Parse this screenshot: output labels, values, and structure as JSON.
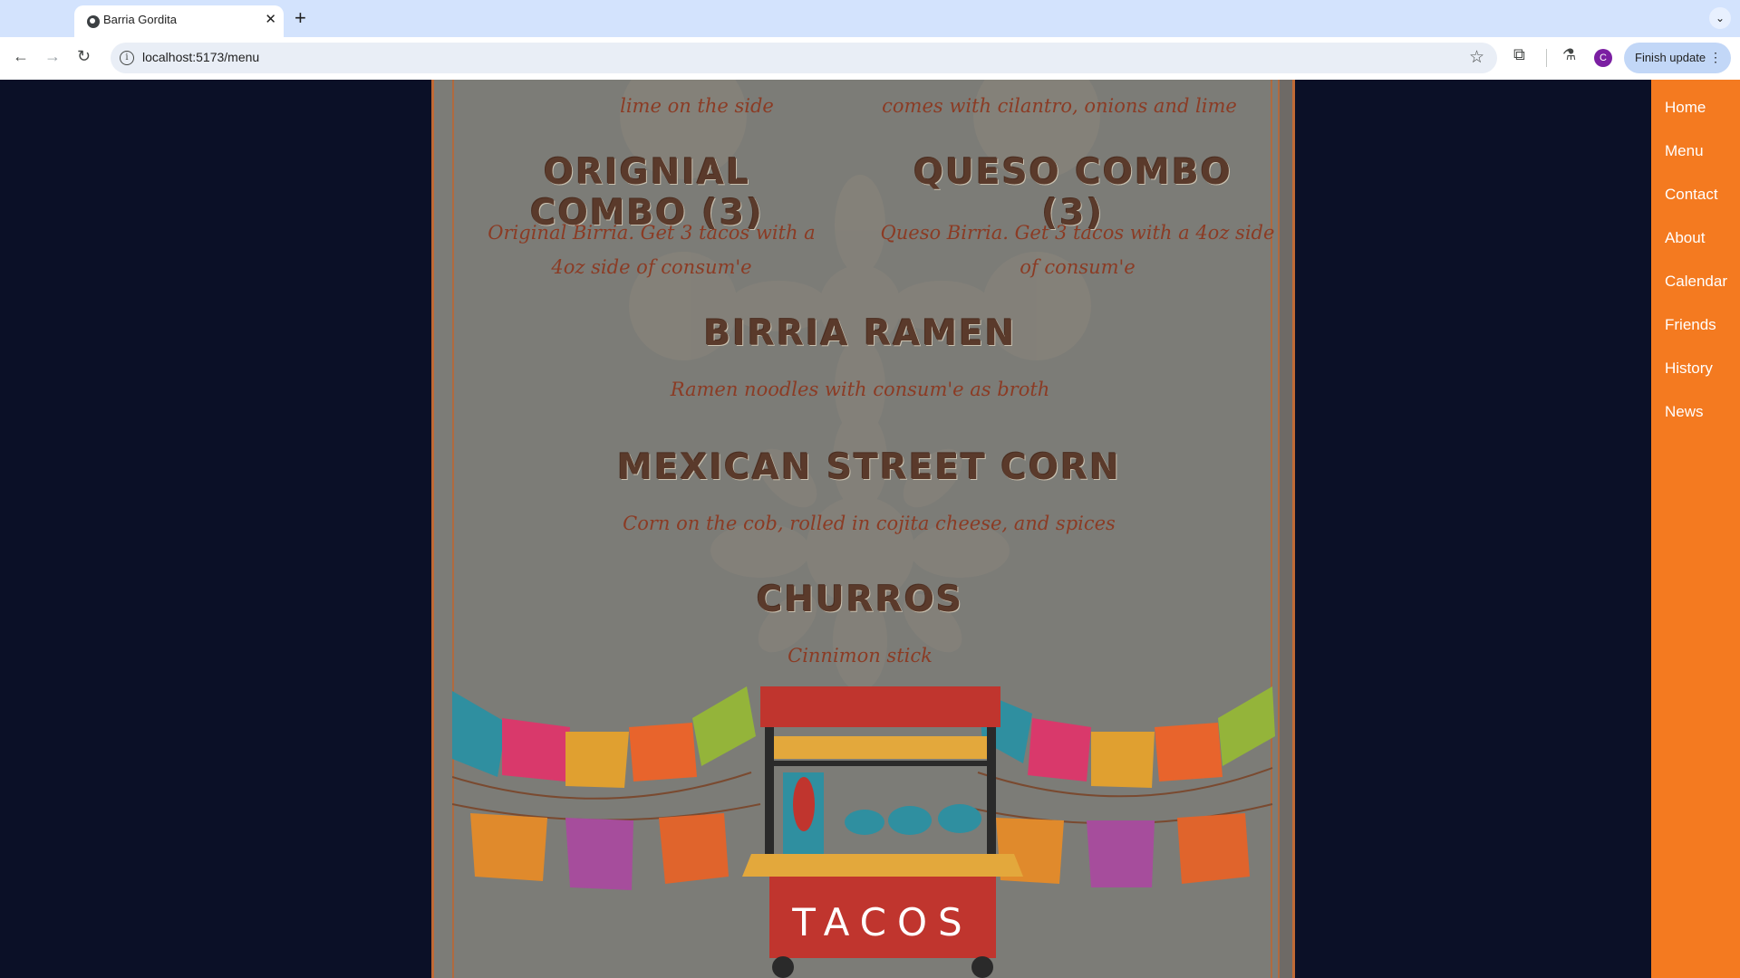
{
  "browser": {
    "tab_title": "Barria Gordita",
    "tab_close": "✕",
    "new_tab": "+",
    "url": "localhost:5173/menu",
    "update_button": "Finish update",
    "avatar_letter": "C"
  },
  "menu": {
    "partial_left_desc": "lime on the side",
    "partial_right_desc": "comes with cilantro, onions and lime",
    "items": [
      {
        "title": "ORIGNIAL COMBO (3)",
        "desc": "Original Birria.  Get 3 tacos with a 4oz side of consum'e"
      },
      {
        "title": "QUESO COMBO (3)",
        "desc": "Queso Birria.  Get 3 tacos with a 4oz side of consum'e"
      },
      {
        "title": "BIRRIA RAMEN",
        "desc": "Ramen noodles with consum'e as broth"
      },
      {
        "title": "MEXICAN STREET CORN",
        "desc": "Corn on the cob, rolled in cojita cheese, and spices"
      },
      {
        "title": "CHURROS",
        "desc": "Cinnimon stick"
      }
    ],
    "cart_sign": "TACOS"
  },
  "sidebar": {
    "links": [
      "Home",
      "Menu",
      "Contact",
      "About",
      "Calendar",
      "Friends",
      "History",
      "News"
    ]
  },
  "colors": {
    "page_bg": "#0b1027",
    "sidebar": "#f47a20",
    "card_bg": "#7c7c77",
    "title_text": "#5a3a2b",
    "desc_text": "#8b3b24"
  }
}
